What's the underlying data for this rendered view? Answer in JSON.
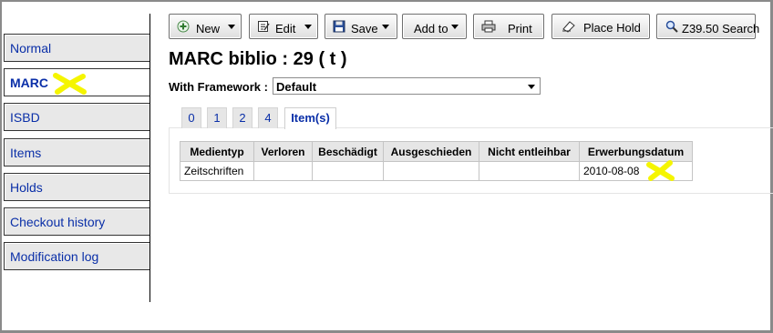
{
  "sidebar": {
    "items": [
      {
        "label": "Normal",
        "active": false
      },
      {
        "label": "MARC",
        "active": true
      },
      {
        "label": "ISBD",
        "active": false
      },
      {
        "label": "Items",
        "active": false
      },
      {
        "label": "Holds",
        "active": false
      },
      {
        "label": "Checkout history",
        "active": false
      },
      {
        "label": "Modification log",
        "active": false
      }
    ]
  },
  "toolbar": {
    "new_label": "New",
    "edit_label": "Edit",
    "save_label": "Save",
    "addto_label": "Add to",
    "print_label": "Print",
    "placehold_label": "Place Hold",
    "z3950_label": "Z39.50 Search"
  },
  "page": {
    "title": "MARC biblio : 29 ( t )",
    "framework_label": "With Framework :",
    "framework_value": "Default"
  },
  "tabs": [
    {
      "label": "0",
      "active": false
    },
    {
      "label": "1",
      "active": false
    },
    {
      "label": "2",
      "active": false
    },
    {
      "label": "4",
      "active": false
    },
    {
      "label": "Item(s)",
      "active": true
    }
  ],
  "items_table": {
    "columns": [
      "Medientyp",
      "Verloren",
      "Beschädigt",
      "Ausgeschieden",
      "Nicht entleihbar",
      "Erwerbungsdatum"
    ],
    "rows": [
      [
        "Zeitschriften",
        "",
        "",
        "",
        "",
        "2010-08-08"
      ]
    ]
  },
  "colors": {
    "link": "#0a2fa8",
    "highlight_mark": "#f5f500"
  }
}
